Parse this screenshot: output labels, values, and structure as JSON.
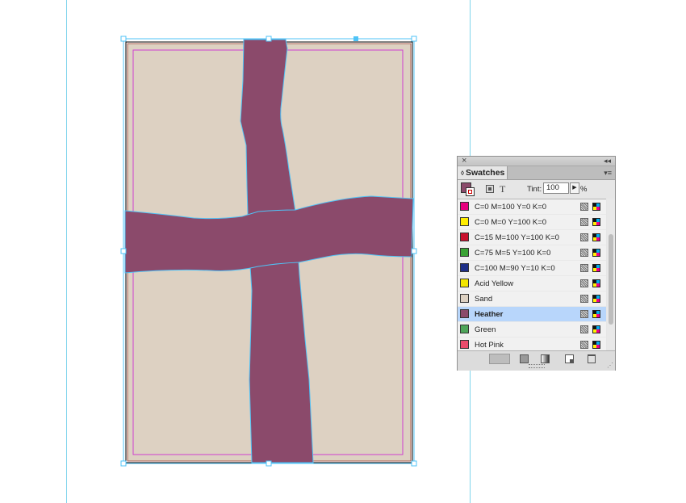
{
  "canvas": {
    "page_color": "#ddd1c2",
    "cross_color": "#8b4a6b",
    "frame_color": "#4fc3f7"
  },
  "swatches_panel": {
    "close_glyph": "×",
    "collapse_glyph": "◂◂",
    "tab_label": "Swatches",
    "tab_glyph": "◊",
    "menu_glyph": "▾≡",
    "text_mode_glyph": "T",
    "tint_label": "Tint:",
    "tint_value": "100",
    "tint_arrow": "▶",
    "tint_unit": "%",
    "active_fill": "#8b4a6b",
    "swatches": [
      {
        "name": "C=0 M=100 Y=0 K=0",
        "color": "#e6007e",
        "selected": false
      },
      {
        "name": "C=0 M=0 Y=100 K=0",
        "color": "#ffed00",
        "selected": false
      },
      {
        "name": "C=15 M=100 Y=100 K=0",
        "color": "#c8102e",
        "selected": false
      },
      {
        "name": "C=75 M=5 Y=100 K=0",
        "color": "#3aa335",
        "selected": false
      },
      {
        "name": "C=100 M=90 Y=10 K=0",
        "color": "#1e2f87",
        "selected": false
      },
      {
        "name": "Acid Yellow",
        "color": "#f2e600",
        "selected": false
      },
      {
        "name": "Sand",
        "color": "#ddd1c2",
        "selected": false
      },
      {
        "name": "Heather",
        "color": "#8b4a6b",
        "selected": true
      },
      {
        "name": "Green",
        "color": "#4ea55a",
        "selected": false
      },
      {
        "name": "Hot Pink",
        "color": "#ea4b6b",
        "selected": false
      }
    ],
    "scroll_position": 0.6
  }
}
